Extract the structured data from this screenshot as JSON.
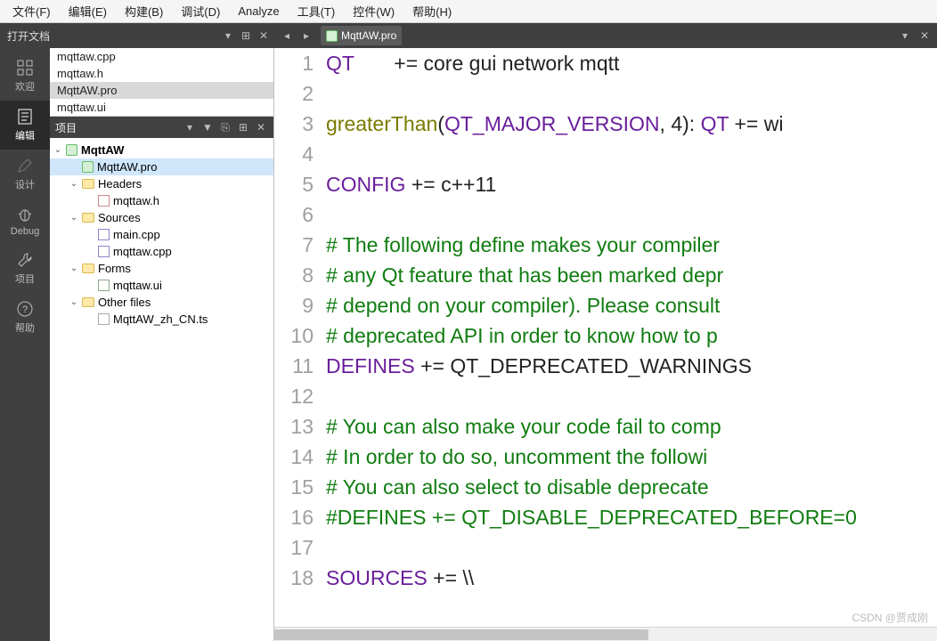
{
  "menu": {
    "file": "文件(F)",
    "edit": "编辑(E)",
    "build": "构建(B)",
    "debug": "调试(D)",
    "analyze": "Analyze",
    "tools": "工具(T)",
    "widgets": "控件(W)",
    "help": "帮助(H)"
  },
  "toolbar": {
    "open_docs_label": "打开文档",
    "project_label": "项目",
    "tab_file": "MqttAW.pro"
  },
  "modes": {
    "welcome": "欢迎",
    "edit": "编辑",
    "design": "设计",
    "debug": "Debug",
    "project": "项目",
    "help": "帮助"
  },
  "open_docs": {
    "items": [
      "mqttaw.cpp",
      "mqttaw.h",
      "MqttAW.pro",
      "mqttaw.ui"
    ],
    "selected": "MqttAW.pro"
  },
  "tree": {
    "root": "MqttAW",
    "pro": "MqttAW.pro",
    "headers": {
      "label": "Headers",
      "items": [
        "mqttaw.h"
      ]
    },
    "sources": {
      "label": "Sources",
      "items": [
        "main.cpp",
        "mqttaw.cpp"
      ]
    },
    "forms": {
      "label": "Forms",
      "items": [
        "mqttaw.ui"
      ]
    },
    "other": {
      "label": "Other files",
      "items": [
        "MqttAW_zh_CN.ts"
      ]
    }
  },
  "editor": {
    "lines": [
      {
        "n": 1,
        "seg": [
          {
            "c": "nm",
            "t": "QT"
          },
          {
            "c": "op",
            "t": "       += "
          },
          {
            "c": "op",
            "t": "core gui network mqtt"
          }
        ]
      },
      {
        "n": 2,
        "seg": []
      },
      {
        "n": 3,
        "seg": [
          {
            "c": "kw",
            "t": "greaterThan"
          },
          {
            "c": "op",
            "t": "("
          },
          {
            "c": "nm",
            "t": "QT_MAJOR_VERSION"
          },
          {
            "c": "op",
            "t": ", "
          },
          {
            "c": "num",
            "t": "4"
          },
          {
            "c": "op",
            "t": "): "
          },
          {
            "c": "nm",
            "t": "QT"
          },
          {
            "c": "op",
            "t": " += wi"
          }
        ]
      },
      {
        "n": 4,
        "seg": []
      },
      {
        "n": 5,
        "seg": [
          {
            "c": "nm",
            "t": "CONFIG"
          },
          {
            "c": "op",
            "t": " += c++11"
          }
        ]
      },
      {
        "n": 6,
        "seg": []
      },
      {
        "n": 7,
        "seg": [
          {
            "c": "cm",
            "t": "# The following define makes your compiler"
          }
        ]
      },
      {
        "n": 8,
        "seg": [
          {
            "c": "cm",
            "t": "# any Qt feature that has been marked depr"
          }
        ]
      },
      {
        "n": 9,
        "seg": [
          {
            "c": "cm",
            "t": "# depend on your compiler). Please consult"
          }
        ]
      },
      {
        "n": 10,
        "seg": [
          {
            "c": "cm",
            "t": "# deprecated API in order to know how to p"
          }
        ]
      },
      {
        "n": 11,
        "seg": [
          {
            "c": "nm",
            "t": "DEFINES"
          },
          {
            "c": "op",
            "t": " += QT_DEPRECATED_WARNINGS"
          }
        ]
      },
      {
        "n": 12,
        "seg": []
      },
      {
        "n": 13,
        "seg": [
          {
            "c": "cm",
            "t": "# You can also make your code fail to comp"
          }
        ]
      },
      {
        "n": 14,
        "seg": [
          {
            "c": "cm",
            "t": "# In order to do so, uncomment the followi"
          }
        ]
      },
      {
        "n": 15,
        "seg": [
          {
            "c": "cm",
            "t": "# You can also select to disable deprecate"
          }
        ]
      },
      {
        "n": 16,
        "seg": [
          {
            "c": "cm",
            "t": "#DEFINES += QT_DISABLE_DEPRECATED_BEFORE=0"
          }
        ]
      },
      {
        "n": 17,
        "seg": []
      },
      {
        "n": 18,
        "seg": [
          {
            "c": "nm",
            "t": "SOURCES"
          },
          {
            "c": "op",
            "t": " += \\\\"
          }
        ]
      }
    ]
  },
  "watermark": "CSDN @贾成刚"
}
